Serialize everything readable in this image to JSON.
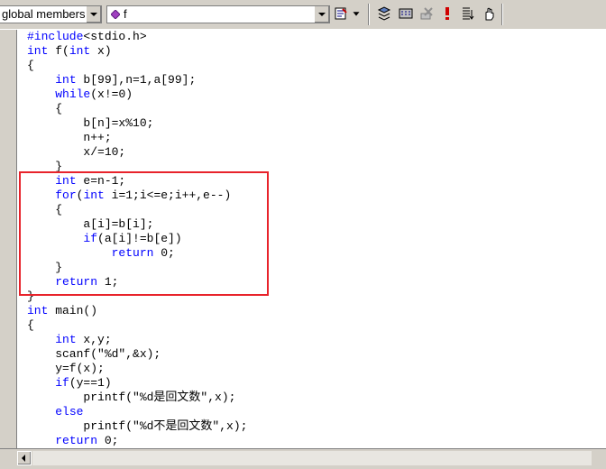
{
  "toolbar": {
    "scope_combo": {
      "value": "global members"
    },
    "function_combo": {
      "value": "f",
      "icon": "purple-diamond-icon"
    },
    "icons": [
      "wizard-bar-icon",
      "compile-icon",
      "build-icon",
      "stop-build-icon",
      "execute-icon",
      "breakpoint-list-icon",
      "go-icon"
    ]
  },
  "editor": {
    "lines": [
      "#include<stdio.h>",
      "int f(int x)",
      "{",
      "    int b[99],n=1,a[99];",
      "    while(x!=0)",
      "    {",
      "        b[n]=x%10;",
      "        n++;",
      "        x/=10;",
      "    }",
      "    int e=n-1;",
      "    for(int i=1;i<=e;i++,e--)",
      "    {",
      "        a[i]=b[i];",
      "        if(a[i]!=b[e])",
      "            return 0;",
      "    }",
      "    return 1;",
      "}",
      "int main()",
      "{",
      "    int x,y;",
      "    scanf(\"%d\",&x);",
      "    y=f(x);",
      "    if(y==1)",
      "        printf(\"%d是回文数\",x);",
      "    else",
      "        printf(\"%d不是回文数\",x);",
      "    return 0;"
    ],
    "keyword_color": "#0000ff",
    "highlight_color": "#e8232b"
  }
}
